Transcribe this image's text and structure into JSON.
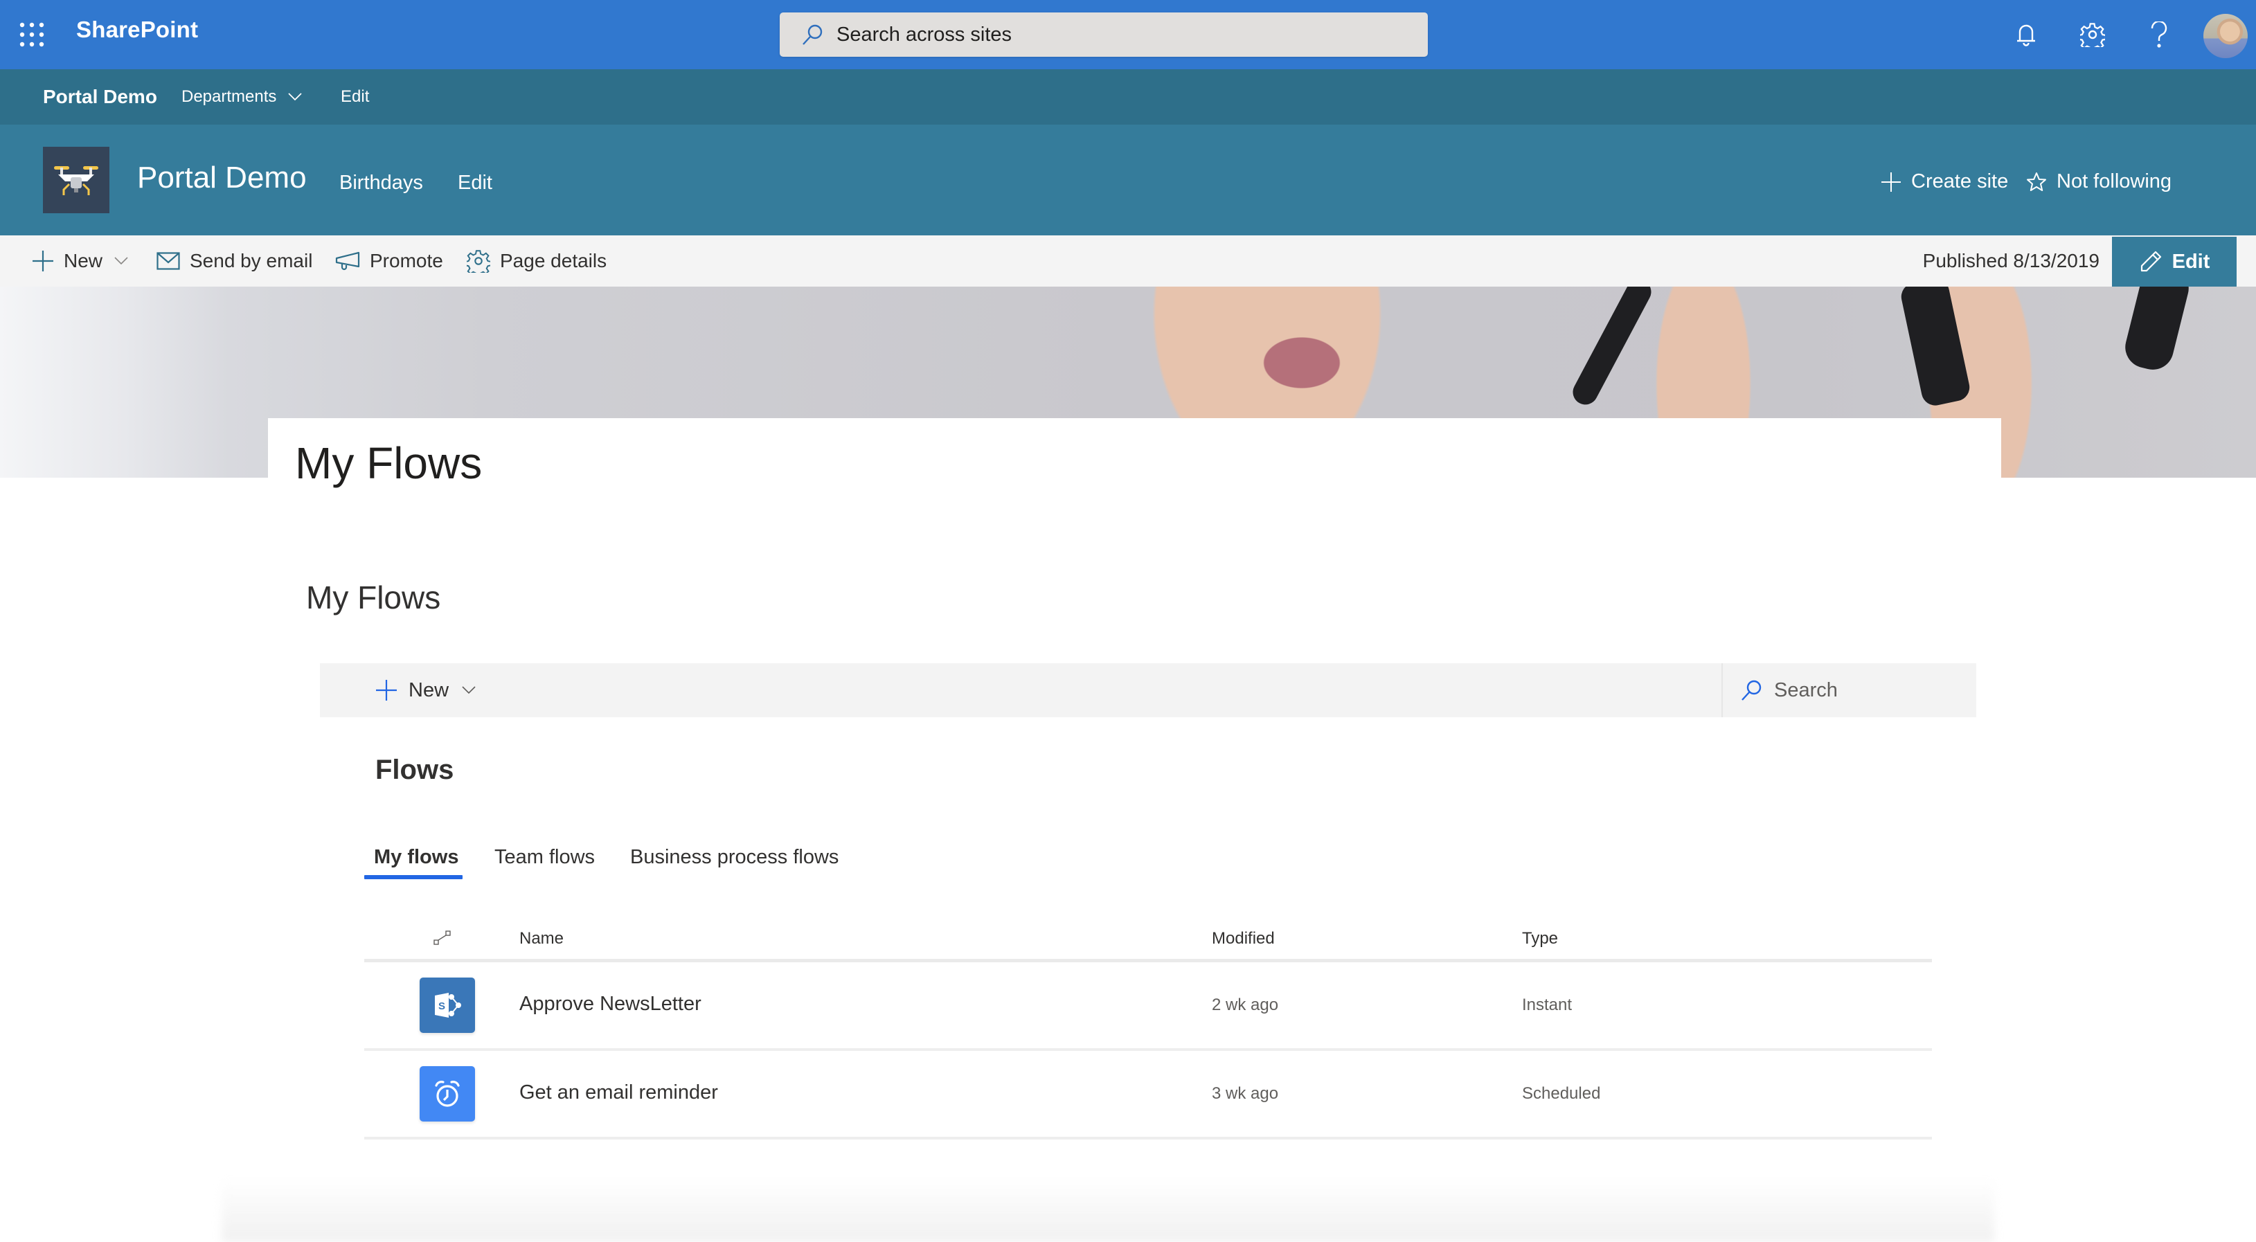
{
  "suite_bar": {
    "app_name": "SharePoint",
    "search_placeholder": "Search across sites",
    "icons": [
      "app-launcher-icon",
      "bell-icon",
      "gear-icon",
      "help-icon",
      "avatar"
    ],
    "bg_color": "#3178cf"
  },
  "hub_nav": {
    "home": "Portal Demo",
    "departments": "Departments",
    "edit": "Edit",
    "bg_color": "#2e6f8a"
  },
  "site_header": {
    "title": "Portal Demo",
    "nav": [
      "Birthdays",
      "Edit"
    ],
    "create_site": "Create site",
    "follow": "Not following",
    "bg_color": "#357c9b"
  },
  "command_bar": {
    "new": "New",
    "send_by_email": "Send by email",
    "promote": "Promote",
    "page_details": "Page details",
    "published": "Published 8/13/2019",
    "edit": "Edit"
  },
  "page": {
    "title": "My Flows"
  },
  "web_part": {
    "title": "My Flows",
    "toolbar": {
      "new": "New",
      "search_placeholder": "Search"
    },
    "heading": "Flows",
    "tabs": [
      {
        "label": "My flows",
        "active": true
      },
      {
        "label": "Team flows",
        "active": false
      },
      {
        "label": "Business process flows",
        "active": false
      }
    ],
    "table": {
      "columns": [
        "Name",
        "Modified",
        "Type"
      ],
      "rows": [
        {
          "icon": "sharepoint-icon",
          "icon_color": "#3a77b8",
          "name": "Approve NewsLetter",
          "modified": "2 wk ago",
          "type": "Instant"
        },
        {
          "icon": "alarm-clock-icon",
          "icon_color": "#4288f4",
          "name": "Get an email reminder",
          "modified": "3 wk ago",
          "type": "Scheduled"
        }
      ]
    },
    "accent_color": "#2266e3"
  }
}
